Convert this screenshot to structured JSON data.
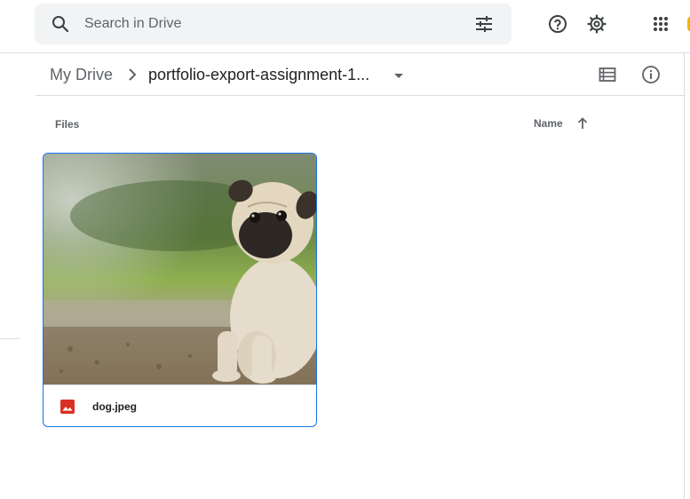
{
  "search": {
    "placeholder": "Search in Drive",
    "value": ""
  },
  "header_icons": [
    "search-icon",
    "tune-icon",
    "help-icon",
    "gear-icon",
    "apps-icon"
  ],
  "breadcrumb": {
    "root": "My Drive",
    "current": "portfolio-export-assignment-1..."
  },
  "list_header": {
    "section": "Files",
    "sort_by": "Name",
    "sort_direction": "ascending"
  },
  "files": [
    {
      "name": "dog.jpeg",
      "type": "image",
      "icon": "image-file-icon",
      "icon_color": "#d93025"
    }
  ],
  "colors": {
    "accent": "#1a73e8",
    "search_bg": "#f1f3f4",
    "text_secondary": "#5f6368"
  }
}
